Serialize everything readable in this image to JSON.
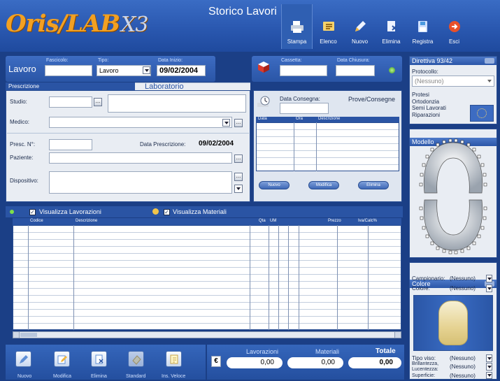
{
  "app": {
    "logo_main": "Oris",
    "logo_sub": "LAB",
    "logo_suffix": "X3",
    "title": "Storico Lavori"
  },
  "toolbar": [
    {
      "label": "Stampa",
      "icon": "printer-icon"
    },
    {
      "label": "Elenco",
      "icon": "list-icon"
    },
    {
      "label": "Nuovo",
      "icon": "pencil-new-icon"
    },
    {
      "label": "Elimina",
      "icon": "delete-icon"
    },
    {
      "label": "Registra",
      "icon": "save-icon"
    },
    {
      "label": "Esci",
      "icon": "exit-icon"
    }
  ],
  "lavoro": {
    "title": "Lavoro",
    "fascicolo_label": "Fascicolo:",
    "fascicolo_value": "",
    "tipo_label": "Tipo:",
    "tipo_value": "Lavoro",
    "data_inizio_label": "Data Inizio:",
    "data_inizio_value": "09/02/2004",
    "cassetta_label": "Cassetta:",
    "cassetta_value": "",
    "data_chiusura_label": "Data Chiusura:",
    "data_chiusura_value": ""
  },
  "tabs": {
    "prescrizione": "Prescrizione",
    "laboratorio": "Laboratorio"
  },
  "prescrizione": {
    "studio_label": "Studio:",
    "medico_label": "Medico:",
    "presc_n_label": "Presc. N°:",
    "data_prescrizione_label": "Data Prescrizione:",
    "data_prescrizione_value": "09/02/2004",
    "paziente_label": "Paziente:",
    "dispositivo_label": "Dispositivo:",
    "browse": "..."
  },
  "consegna": {
    "data_consegna_label": "Data Consegna:",
    "prove_label": "Prove/Consegne",
    "columns": [
      "Data",
      "Ora",
      "Descrizione"
    ],
    "buttons": [
      "Nuovo",
      "Modifica",
      "Elimina"
    ]
  },
  "lavorazioni": {
    "check1_label": "Visualizza Lavorazioni",
    "check2_label": "Visualizza Materiali",
    "columns": [
      "Codice",
      "Descrizione",
      "Qta",
      "UM",
      "Prezzo",
      "Iva/Calc%"
    ]
  },
  "bottom_buttons": [
    "Nuovo",
    "Modifica",
    "Elimina",
    "Standard",
    "Ins. Veloce"
  ],
  "totals": {
    "currency": "€",
    "lavorazioni_label": "Lavorazioni",
    "materiali_label": "Materiali",
    "totale_label": "Totale",
    "lavorazioni_value": "0,00",
    "materiali_value": "0,00",
    "totale_value": "0,00"
  },
  "direttiva": {
    "title": "Direttiva 93/42",
    "protocollo_label": "Protocollo:",
    "protocollo_value": "(Nessuno)",
    "items": [
      "Protesi",
      "Ortodonzia",
      "Semi Lavorati",
      "Riparazioni"
    ]
  },
  "modello": {
    "title": "Modello"
  },
  "colore": {
    "title": "Colore",
    "campionario_label": "Campionario:",
    "campionario_value": "(Nessuno)",
    "colore_label": "Colore:",
    "colore_value": "(Nessuno)",
    "tipo_viso_label": "Tipo viso:",
    "tipo_viso_value": "(Nessuno)",
    "brillantezza_label": "Brillantezza,",
    "lucentezza_label": "Lucentezza:",
    "brillantezza_value": "(Nessuno)",
    "superficie_label": "Superficie:",
    "superficie_value": "(Nessuno)"
  },
  "colors": {
    "accent": "#2a54a4",
    "background": "#1b3f86",
    "panel": "#e9edf3",
    "logo": "#f2a022"
  }
}
